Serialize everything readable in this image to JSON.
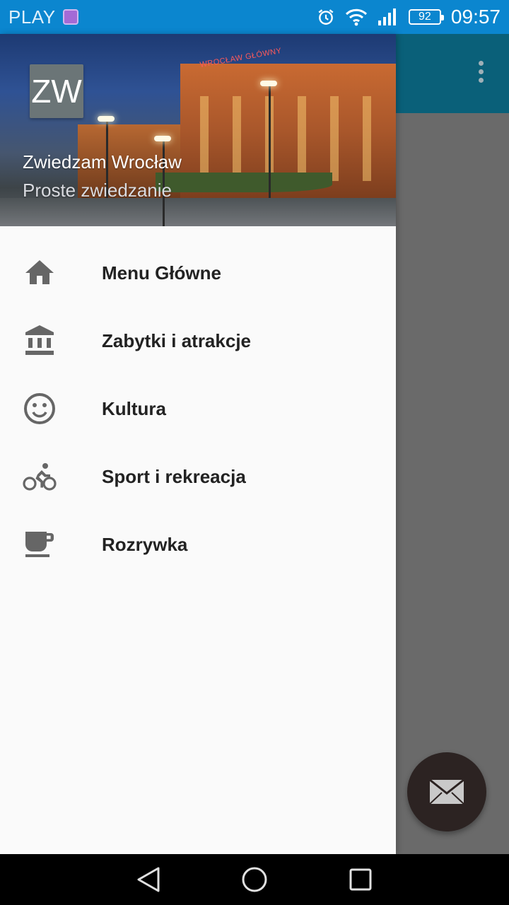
{
  "status_bar": {
    "carrier": "PLAY",
    "battery": "92",
    "time": "09:57"
  },
  "drawer": {
    "header": {
      "avatar_text": "ZW",
      "title": "Zwiedzam Wrocław",
      "subtitle": "Proste zwiedzanie",
      "sign_text": "WROCŁAW GŁÓWNY"
    },
    "items": [
      {
        "label": "Menu Główne",
        "icon": "home-icon"
      },
      {
        "label": "Zabytki i atrakcje",
        "icon": "museum-icon"
      },
      {
        "label": "Kultura",
        "icon": "smiley-icon"
      },
      {
        "label": "Sport i rekreacja",
        "icon": "bike-icon"
      },
      {
        "label": "Rozrywka",
        "icon": "coffee-cup-icon"
      }
    ]
  },
  "colors": {
    "status_bar": "#0b86cf",
    "toolbar": "#0a6079",
    "fab": "#2c2322",
    "drawer_bg": "#fafafa",
    "icon": "#666666"
  }
}
